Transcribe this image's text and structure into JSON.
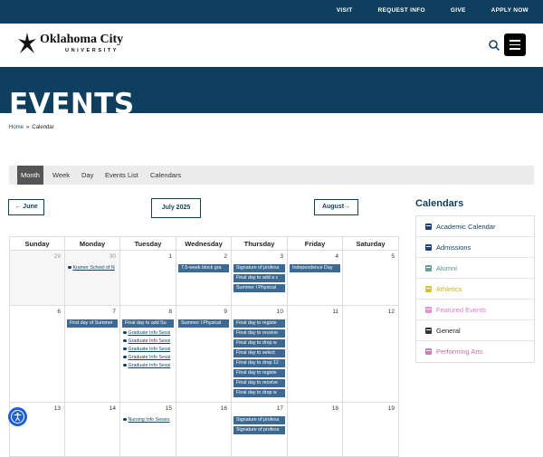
{
  "topbar": {
    "links": [
      "VISIT",
      "REQUEST INFO",
      "GIVE",
      "APPLY NOW"
    ]
  },
  "header": {
    "logo_line1": "Oklahoma City",
    "logo_line2": "UNIVERSITY",
    "search_icon": "search-icon",
    "menu_icon": "hamburger-menu-icon"
  },
  "hero": {
    "title": "EVENTS"
  },
  "breadcrumb": {
    "home": "Home",
    "separator": "»",
    "current": "Calendar"
  },
  "views": [
    "Month",
    "Week",
    "Day",
    "Events List",
    "Calendars"
  ],
  "active_view": "Month",
  "nav": {
    "prev": "June",
    "current": "July 2025",
    "next": "August"
  },
  "weekdays": [
    "Sunday",
    "Monday",
    "Tuesday",
    "Wednesday",
    "Thursday",
    "Friday",
    "Saturday"
  ],
  "weeks": [
    {
      "days": [
        {
          "num": "29",
          "other": true,
          "events": []
        },
        {
          "num": "30",
          "other": true,
          "events": [
            {
              "dot": true,
              "text": "Kramer School of N"
            }
          ]
        },
        {
          "num": "1",
          "events": []
        },
        {
          "num": "2",
          "events": [
            {
              "text": "7.5-week block gra"
            }
          ]
        },
        {
          "num": "3",
          "events": [
            {
              "text": "Signature of profess"
            },
            {
              "text": "Final day to add a c"
            },
            {
              "text": "Summer I Physical"
            }
          ]
        },
        {
          "num": "4",
          "events": [
            {
              "text": "Independence Day"
            }
          ]
        },
        {
          "num": "5",
          "events": []
        }
      ]
    },
    {
      "days": [
        {
          "num": "6",
          "events": []
        },
        {
          "num": "7",
          "events": [
            {
              "text": "First day of Summer"
            }
          ]
        },
        {
          "num": "8",
          "events": [
            {
              "text": "Final day to add Su"
            },
            {
              "dot": true,
              "text": "Graduate Info Sessi"
            },
            {
              "dot": true,
              "text": "Graduate Info Sessi"
            },
            {
              "dot": true,
              "text": "Graduate Info Sessi"
            },
            {
              "dot": true,
              "text": "Graduate Info Sessi"
            },
            {
              "dot": true,
              "text": "Graduate Info Sessi"
            }
          ]
        },
        {
          "num": "9",
          "events": [
            {
              "text": "Summer I Physical"
            }
          ]
        },
        {
          "num": "10",
          "events": [
            {
              "text": "Final day to registe"
            },
            {
              "text": "Final day to receive"
            },
            {
              "text": "Final day to drop w"
            },
            {
              "text": "Final day to select"
            },
            {
              "text": "Final day to drop 12"
            },
            {
              "text": "Final day to registe"
            },
            {
              "text": "Final day to receive"
            },
            {
              "text": "Final day to drop w"
            }
          ]
        },
        {
          "num": "11",
          "events": []
        },
        {
          "num": "12",
          "events": []
        }
      ]
    },
    {
      "days": [
        {
          "num": "13",
          "events": []
        },
        {
          "num": "14",
          "events": []
        },
        {
          "num": "15",
          "events": [
            {
              "dot": true,
              "text": "Nursing Info Sessio"
            }
          ]
        },
        {
          "num": "16",
          "events": []
        },
        {
          "num": "17",
          "events": [
            {
              "text": "Signature of profess"
            },
            {
              "text": "Signature of profess"
            }
          ]
        },
        {
          "num": "18",
          "events": []
        },
        {
          "num": "19",
          "events": []
        }
      ]
    }
  ],
  "sidebar": {
    "title": "Calendars",
    "items": [
      {
        "label": "Academic Calendar",
        "color": "#1f3f7a",
        "text_color": "#0f3f5f"
      },
      {
        "label": "Admissions",
        "color": "#1f3f7a",
        "text_color": "#0f3f5f"
      },
      {
        "label": "Alumni",
        "color": "#6a9a9a",
        "text_color": "#5a8f8f"
      },
      {
        "label": "Athletics",
        "color": "#d9c22a",
        "text_color": "#cdb315"
      },
      {
        "label": "Featured Events",
        "color": "#e88fcf",
        "text_color": "#e07cc6"
      },
      {
        "label": "General",
        "color": "#333333",
        "text_color": "#222222"
      },
      {
        "label": "Performing Arts",
        "color": "#c77fb0",
        "text_color": "#c070a8"
      }
    ]
  },
  "accessibility_icon": "accessibility-icon",
  "colors": {
    "brand": "#0f3f5f",
    "event": "#3d6a93"
  }
}
